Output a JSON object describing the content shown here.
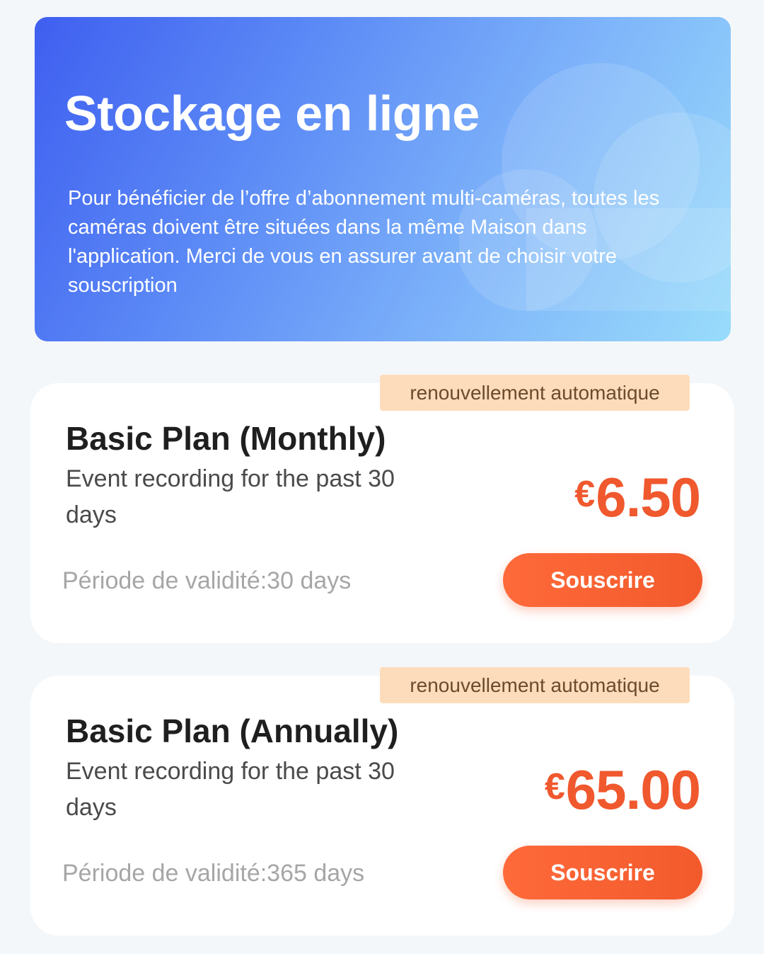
{
  "colors": {
    "background": "#f4f7fa",
    "hero_start": "#3f5ff0",
    "hero_end": "#99dcfb",
    "price": "#f0582e",
    "button": "#f25a2c",
    "badge_bg": "#fddcbb",
    "badge_text": "#6b4a2e"
  },
  "header": {
    "title": "Stockage en ligne",
    "description": "Pour bénéficier de l’offre d’abonnement multi-caméras, toutes les caméras doivent être situées dans la même Maison dans l'application. Merci de vous en assurer avant de choisir votre souscription",
    "decoration_icon": "cloud-icon"
  },
  "plans": [
    {
      "badge": "renouvellement automatique",
      "name": "Basic Plan (Monthly)",
      "description": "Event recording for the past 30 days",
      "currency": "€",
      "price": "6.50",
      "validity": "Période de validité:30 days",
      "button_label": "Souscrire"
    },
    {
      "badge": "renouvellement automatique",
      "name": "Basic Plan (Annually)",
      "description": "Event recording for the past 30 days",
      "currency": "€",
      "price": "65.00",
      "validity": "Période de validité:365 days",
      "button_label": "Souscrire"
    }
  ]
}
